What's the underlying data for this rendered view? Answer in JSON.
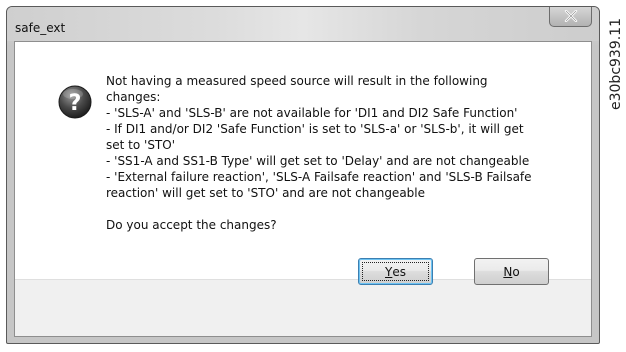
{
  "window": {
    "title": "safe_ext",
    "close_icon": "close-icon"
  },
  "dialog": {
    "icon": "question-icon",
    "message_lines": [
      "Not having a measured speed source will result in the following",
      "changes:",
      "- 'SLS-A' and 'SLS-B' are not available for 'DI1 and DI2 Safe Function'",
      "- If DI1 and/or DI2 'Safe Function' is set to 'SLS-a' or 'SLS-b', it will get",
      "set to 'STO'",
      "- 'SS1-A and SS1-B Type' will get set to 'Delay' and are not changeable",
      "- 'External failure reaction', 'SLS-A Failsafe reaction' and 'SLS-B Failsafe",
      "reaction' will get set to 'STO' and are not changeable"
    ],
    "question": "Do you accept the changes?"
  },
  "buttons": {
    "yes": {
      "mnemonic": "Y",
      "rest": "es"
    },
    "no": {
      "mnemonic": "N",
      "rest": "o"
    }
  },
  "figure_code": "e30bc939.11"
}
